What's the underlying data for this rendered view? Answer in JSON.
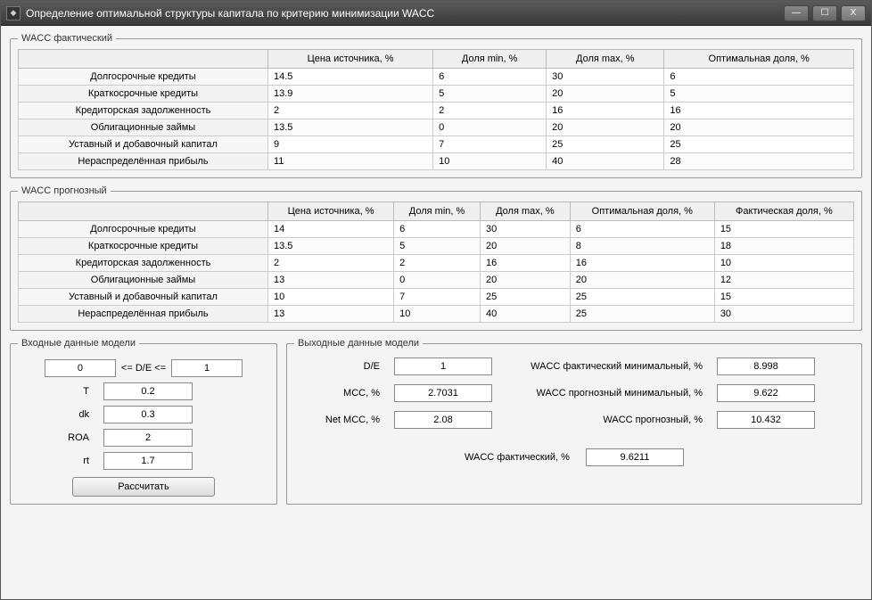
{
  "window": {
    "title": "Определение оптимальной структуры капитала по критерию минимизации WACC",
    "icon_glyph": "◆"
  },
  "win_buttons": {
    "min": "—",
    "max": "☐",
    "close": "X"
  },
  "factual": {
    "legend": "WACC фактический",
    "headers": [
      "Цена источника, %",
      "Доля min, %",
      "Доля max, %",
      "Оптимальная доля, %"
    ],
    "rows": [
      {
        "name": "Долгосрочные кредиты",
        "vals": [
          "14.5",
          "6",
          "30",
          "6"
        ]
      },
      {
        "name": "Краткосрочные кредиты",
        "vals": [
          "13.9",
          "5",
          "20",
          "5"
        ]
      },
      {
        "name": "Кредиторская задолженность",
        "vals": [
          "2",
          "2",
          "16",
          "16"
        ]
      },
      {
        "name": "Облигационные займы",
        "vals": [
          "13.5",
          "0",
          "20",
          "20"
        ]
      },
      {
        "name": "Уставный и добавочный капитал",
        "vals": [
          "9",
          "7",
          "25",
          "25"
        ]
      },
      {
        "name": "Нераспределённая прибыль",
        "vals": [
          "11",
          "10",
          "40",
          "28"
        ]
      }
    ]
  },
  "forecast": {
    "legend": "WACC прогнозный",
    "headers": [
      "Цена источника, %",
      "Доля min, %",
      "Доля max, %",
      "Оптимальная доля, %",
      "Фактическая доля, %"
    ],
    "rows": [
      {
        "name": "Долгосрочные кредиты",
        "vals": [
          "14",
          "6",
          "30",
          "6",
          "15"
        ]
      },
      {
        "name": "Краткосрочные кредиты",
        "vals": [
          "13.5",
          "5",
          "20",
          "8",
          "18"
        ]
      },
      {
        "name": "Кредиторская задолженность",
        "vals": [
          "2",
          "2",
          "16",
          "16",
          "10"
        ]
      },
      {
        "name": "Облигационные займы",
        "vals": [
          "13",
          "0",
          "20",
          "20",
          "12"
        ]
      },
      {
        "name": "Уставный и добавочный капитал",
        "vals": [
          "10",
          "7",
          "25",
          "25",
          "15"
        ]
      },
      {
        "name": "Нераспределённая прибыль",
        "vals": [
          "13",
          "10",
          "40",
          "25",
          "30"
        ]
      }
    ]
  },
  "inputs": {
    "legend": "Входные данные модели",
    "de_low": "0",
    "de_label": "<= D/E <=",
    "de_high": "1",
    "T_label": "T",
    "T": "0.2",
    "dk_label": "dk",
    "dk": "0.3",
    "ROA_label": "ROA",
    "ROA": "2",
    "rt_label": "rt",
    "rt": "1.7",
    "calc_label": "Рассчитать"
  },
  "outputs": {
    "legend": "Выходные данные модели",
    "de_label": "D/E",
    "de": "1",
    "mcc_label": "MCC, %",
    "mcc": "2.7031",
    "netmcc_label": "Net MCC, %",
    "netmcc": "2.08",
    "wacc_fact_min_label": "WACC фактический минимальный, %",
    "wacc_fact_min": "8.998",
    "wacc_prog_min_label": "WACC прогнозный минимальный, %",
    "wacc_prog_min": "9.622",
    "wacc_prog_label": "WACC прогнозный, %",
    "wacc_prog": "10.432",
    "wacc_fact_label": "WACC фактический, %",
    "wacc_fact": "9.6211"
  }
}
